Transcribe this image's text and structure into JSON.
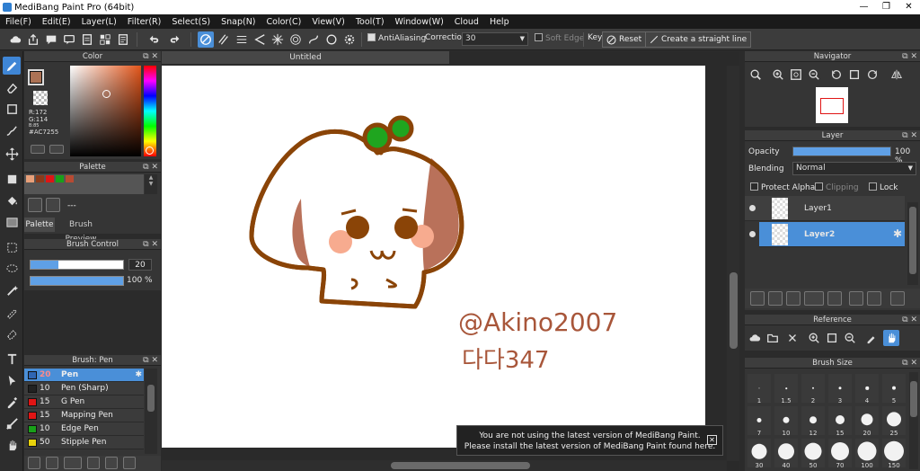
{
  "window": {
    "title": "MediBang Paint Pro (64bit)",
    "minimize": "—",
    "maximize": "❐",
    "close": "✕"
  },
  "menu": [
    "File(F)",
    "Edit(E)",
    "Layer(L)",
    "Filter(R)",
    "Select(S)",
    "Snap(N)",
    "Color(C)",
    "View(V)",
    "Tool(T)",
    "Window(W)",
    "Cloud",
    "Help"
  ],
  "toolbar": {
    "antialiasing_label": "AntiAliasing",
    "correction_label": "Correction",
    "correction_value": "30",
    "soft_edge_label": "Soft Edge",
    "key_label": "Key",
    "reset_label": "Reset",
    "straight_line_label": "Create a straight line"
  },
  "color_panel": {
    "title": "Color",
    "r": "R:172",
    "g": "G:114",
    "b": "B:85",
    "hex": "#AC7255",
    "current_color": "#ac7255"
  },
  "palette_panel": {
    "title": "Palette",
    "swatches": [
      "#e8a07a",
      "#8b3a1a",
      "#e01515",
      "#19a019",
      "#b84a32"
    ],
    "item_text": "---",
    "tab_palette": "Palette",
    "tab_brush_preview": "Brush Preview"
  },
  "brush_control": {
    "title": "Brush Control",
    "size_value": "20",
    "size_fraction": 0.3,
    "opacity_value": "100 %",
    "opacity_fraction": 1.0
  },
  "brush_list": {
    "title": "Brush: Pen",
    "items": [
      {
        "size": "20",
        "name": "Pen",
        "color": "#2f66b3"
      },
      {
        "size": "10",
        "name": "Pen (Sharp)",
        "color": "#222222"
      },
      {
        "size": "15",
        "name": "G Pen",
        "color": "#e01515"
      },
      {
        "size": "15",
        "name": "Mapping Pen",
        "color": "#e01515"
      },
      {
        "size": "10",
        "name": "Edge Pen",
        "color": "#19a019"
      },
      {
        "size": "50",
        "name": "Stipple Pen",
        "color": "#e8d20c"
      }
    ]
  },
  "document": {
    "tab_title": "Untitled"
  },
  "canvas_art": {
    "signature_line1": "@Akino2007",
    "signature_line2": "다다347"
  },
  "toast": {
    "line1": "You are not using the latest version of MediBang Paint.",
    "line2": "Please install the latest version of MediBang Paint found here.",
    "close": "✕"
  },
  "navigator": {
    "title": "Navigator"
  },
  "layer_panel": {
    "title": "Layer",
    "opacity_label": "Opacity",
    "opacity_value": "100 %",
    "opacity_fraction": 1.0,
    "blending_label": "Blending",
    "blending_value": "Normal",
    "protect_alpha": "Protect Alpha",
    "clipping": "Clipping",
    "lock": "Lock",
    "layers": [
      {
        "name": "Layer1",
        "selected": false
      },
      {
        "name": "Layer2",
        "selected": true
      }
    ]
  },
  "reference_panel": {
    "title": "Reference"
  },
  "brush_size_panel": {
    "title": "Brush Size",
    "sizes": [
      "1",
      "1.5",
      "2",
      "3",
      "4",
      "5",
      "7",
      "10",
      "12",
      "15",
      "20",
      "25",
      "30",
      "40",
      "50",
      "70",
      "100",
      "150"
    ]
  }
}
